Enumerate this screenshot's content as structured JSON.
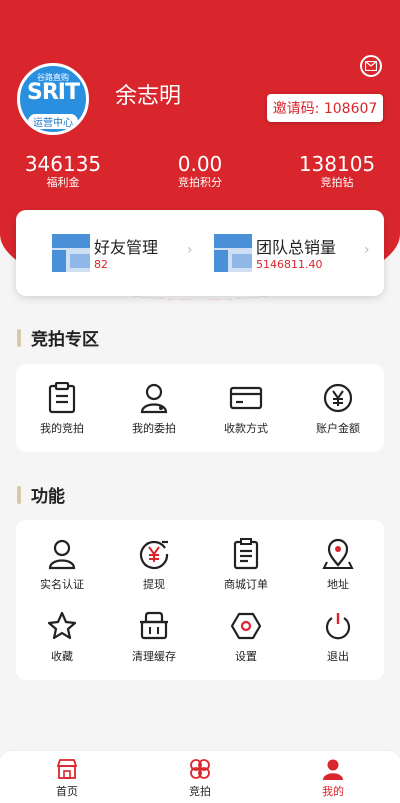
{
  "header": {
    "avatar_brand_top": "谷路直购",
    "avatar_brand_main": "SRIT",
    "avatar_brand_sub": "运营中心",
    "user_name": "余志明",
    "invite_code": "邀请码: 108607"
  },
  "stats": [
    {
      "value": "346135",
      "label": "福利金"
    },
    {
      "value": "0.00",
      "label": "竞拍积分"
    },
    {
      "value": "138105",
      "label": "竞拍钻"
    }
  ],
  "summary": {
    "friends": {
      "title": "好友管理",
      "value": "82"
    },
    "team": {
      "title": "团队总销量",
      "value": "5146811.40"
    }
  },
  "auction_section": {
    "title": "竞拍专区",
    "items": [
      {
        "label": "我的竞拍",
        "icon": "clipboard-icon"
      },
      {
        "label": "我的委拍",
        "icon": "user-icon"
      },
      {
        "label": "收款方式",
        "icon": "card-icon"
      },
      {
        "label": "账户金额",
        "icon": "yen-circle-icon"
      }
    ]
  },
  "function_section": {
    "title": "功能",
    "items": [
      {
        "label": "实名认证",
        "icon": "person-icon"
      },
      {
        "label": "提现",
        "icon": "yen-withdraw-icon"
      },
      {
        "label": "商城订单",
        "icon": "order-icon"
      },
      {
        "label": "地址",
        "icon": "location-icon"
      },
      {
        "label": "收藏",
        "icon": "star-icon"
      },
      {
        "label": "清理缓存",
        "icon": "basket-icon"
      },
      {
        "label": "设置",
        "icon": "settings-icon"
      },
      {
        "label": "退出",
        "icon": "power-icon"
      }
    ]
  },
  "tabbar": {
    "items": [
      {
        "label": "首页",
        "icon": "shop-icon"
      },
      {
        "label": "竞拍",
        "icon": "clover-icon"
      },
      {
        "label": "我的",
        "icon": "profile-icon"
      }
    ],
    "active_index": 2
  },
  "colors": {
    "brand": "#d9262c",
    "background": "#f5f5f5"
  }
}
